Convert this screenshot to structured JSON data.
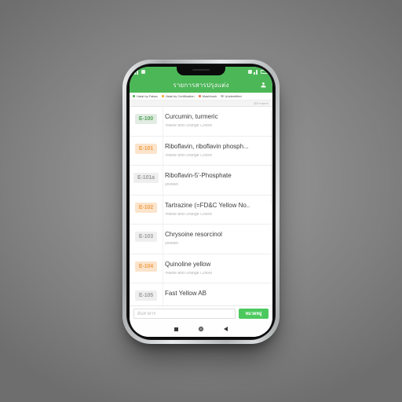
{
  "statusbar": {
    "left_icons": [
      "signal-icon",
      "app-notification-icon"
    ],
    "right_icons": [
      "wifi-icon",
      "signal-bars-icon",
      "battery-icon"
    ]
  },
  "appbar": {
    "title": "รายการสารปรุงแต่ง",
    "account_icon": "account-icon"
  },
  "legend": [
    {
      "label": "Halal by Fatwa",
      "color": "#4caf50"
    },
    {
      "label": "Halal by Certification",
      "color": "#f5a623"
    },
    {
      "label": "Mashbooh",
      "color": "#ef6c3a"
    },
    {
      "label": "Unidentified",
      "color": "#bdbdbd"
    }
  ],
  "count": {
    "text": "374 รายการ"
  },
  "list": {
    "rows": [
      {
        "code": "E-100",
        "status": "green",
        "title": "Curcumin, turmeric",
        "subtitle": "Yellow and Orange Colors"
      },
      {
        "code": "E-101",
        "status": "orange",
        "title": "Riboflavin, riboflavin phosph...",
        "subtitle": "Yellow and Orange Colors"
      },
      {
        "code": "E-101a",
        "status": "gray",
        "title": "Riboflavin-5'-Phosphate",
        "subtitle": "yellows"
      },
      {
        "code": "E-102",
        "status": "orange",
        "title": "Tartrazine (=FD&C Yellow No..",
        "subtitle": "Yellow and Orange Colors"
      },
      {
        "code": "E-103",
        "status": "gray",
        "title": "Chrysoine resorcinol",
        "subtitle": "yellows"
      },
      {
        "code": "E-104",
        "status": "orange",
        "title": "Quinoline yellow",
        "subtitle": "Yellow and Orange Colors"
      },
      {
        "code": "E-105",
        "status": "gray",
        "title": "Fast Yellow AB",
        "subtitle": ""
      }
    ]
  },
  "search": {
    "placeholder": "ค้นหาสาร",
    "value": "",
    "category_label": "หมวดหมู่"
  },
  "navbar": {
    "recents": "recents-square-icon",
    "home": "home-circle-icon",
    "back": "back-triangle-icon"
  },
  "colors": {
    "brand_green": "#4cb757",
    "button_green": "#4cc95e",
    "background_gray": "#8d8d8d"
  }
}
